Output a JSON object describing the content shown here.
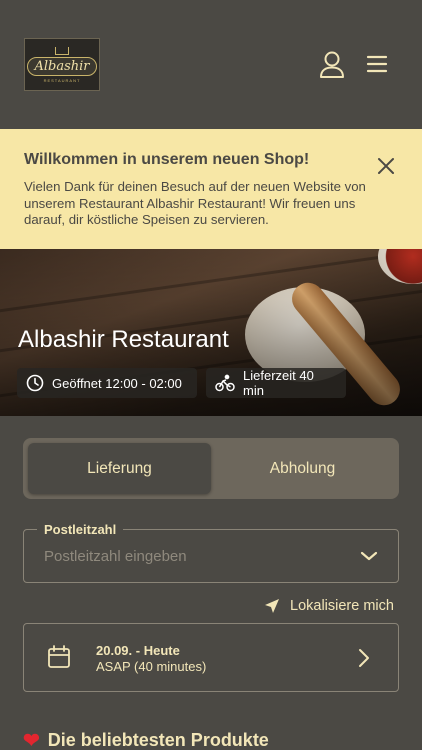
{
  "brand": {
    "logo_text": "Albashir",
    "logo_subtext": "RESTAURANT"
  },
  "banner": {
    "title": "Willkommen in unserem neuen Shop!",
    "text": "Vielen Dank für deinen Besuch auf der neuen Website von unserem Restaurant Albashir Restaurant! Wir freuen uns darauf, dir köstliche Speisen zu servieren."
  },
  "restaurant": {
    "name": "Albashir Restaurant",
    "opening_hours": "Geöffnet 12:00 - 02:00",
    "delivery_time": "Lieferzeit 40 min"
  },
  "order_type": {
    "delivery": "Lieferung",
    "pickup": "Abholung",
    "selected": "delivery"
  },
  "postcode": {
    "label": "Postleitzahl",
    "placeholder": "Postleitzahl eingeben",
    "value": ""
  },
  "locate": {
    "label": "Lokalisiere mich"
  },
  "schedule": {
    "date": "20.09. - Heute",
    "time": "ASAP (40 minutes)"
  },
  "popular": {
    "title": "Die beliebtesten Produkte"
  },
  "colors": {
    "background": "#4b4944",
    "accent_text": "#f2e6b8",
    "banner": "#f7e7a6",
    "heart": "#e3262f"
  },
  "icons": [
    "user-icon",
    "menu-icon",
    "close-icon",
    "clock-icon",
    "bicycle-icon",
    "chevron-down-icon",
    "location-arrow-icon",
    "calendar-icon",
    "chevron-right-icon",
    "heart-icon"
  ]
}
